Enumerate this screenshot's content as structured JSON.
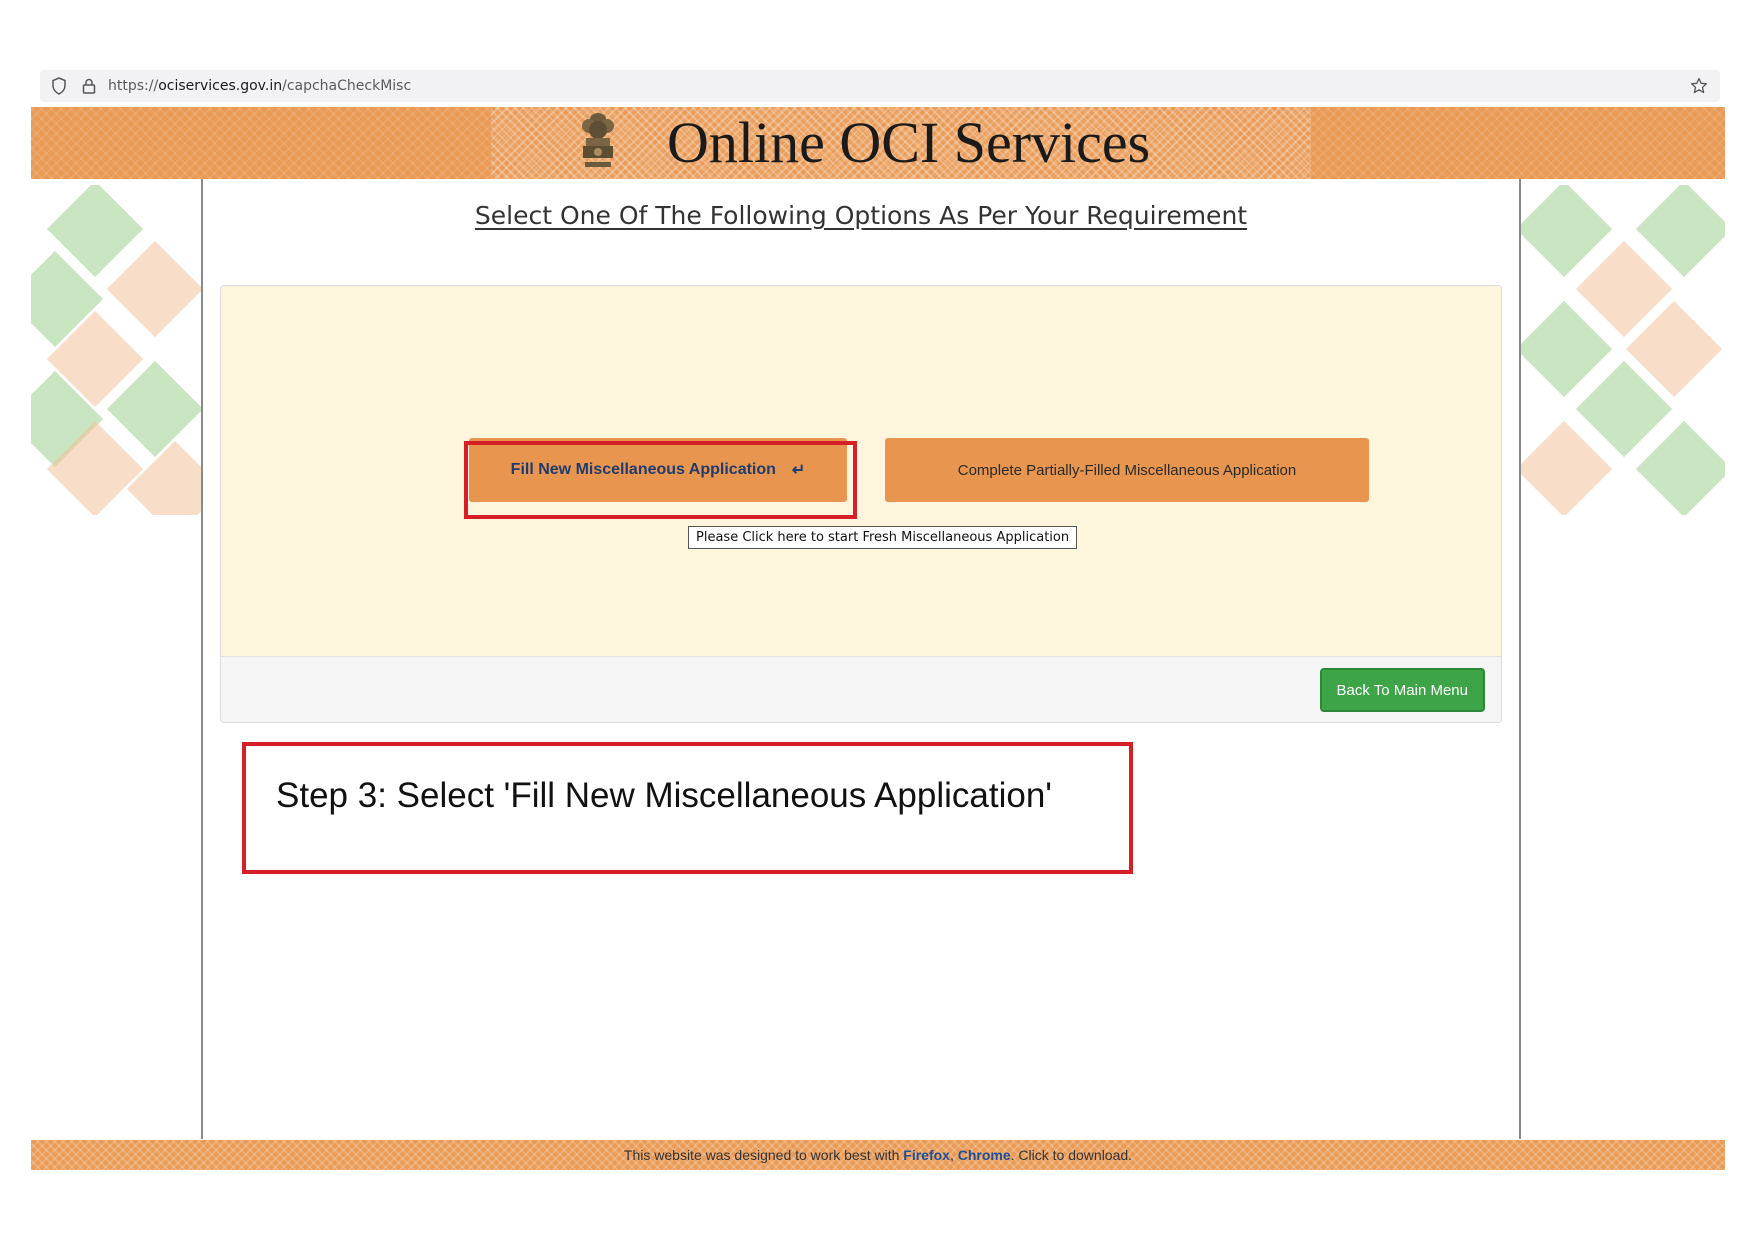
{
  "browser": {
    "url_prefix": "https://",
    "url_host": "ociservices.gov.in",
    "url_path": "/capchaCheckMisc"
  },
  "banner": {
    "title": "Online OCI Services"
  },
  "page": {
    "heading": "Select One Of The Following Options As Per Your Requirement"
  },
  "options": {
    "fill_new_label": "Fill New Miscellaneous Application",
    "fill_new_arrow": "↵",
    "partial_label": "Complete Partially-Filled Miscellaneous Application",
    "tooltip": "Please Click here to start Fresh Miscellaneous  Application"
  },
  "footer_bar": {
    "back_label": "Back To Main Menu"
  },
  "annotation": {
    "step_text": "Step 3: Select 'Fill New Miscellaneous Application'"
  },
  "site_footer": {
    "text_before": "This website was designed to work best with ",
    "firefox": "Firefox",
    "sep": ", ",
    "chrome": "Chrome",
    "text_after": ". Click to download."
  },
  "colors": {
    "banner_orange": "#e99a55",
    "button_orange": "#e8964f",
    "highlight_red": "#d61f26",
    "back_green": "#3da547",
    "card_cream": "#fef6dc"
  },
  "icons": {
    "shield": "shield-icon",
    "lock": "lock-icon",
    "star": "star-icon",
    "emblem": "emblem-icon"
  }
}
